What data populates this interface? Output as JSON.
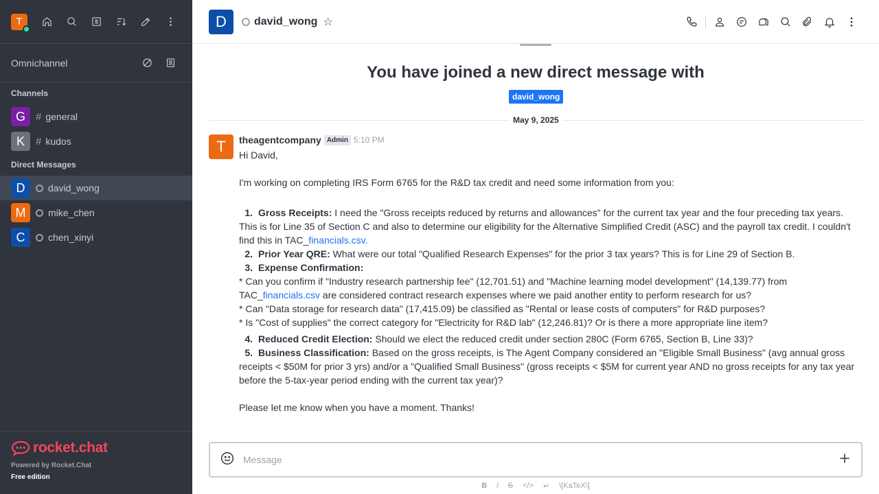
{
  "sidebar": {
    "user_avatar_letter": "T",
    "omnichannel_label": "Omnichannel",
    "channels_title": "Channels",
    "channels": [
      {
        "letter": "G",
        "name": "general",
        "color": "#7a1fa2"
      },
      {
        "letter": "K",
        "name": "kudos",
        "color": "#6c727a"
      }
    ],
    "dm_title": "Direct Messages",
    "dms": [
      {
        "letter": "D",
        "name": "david_wong",
        "color": "#0d4fa8"
      },
      {
        "letter": "M",
        "name": "mike_chen",
        "color": "#ec6b12"
      },
      {
        "letter": "C",
        "name": "chen_xinyi",
        "color": "#0d4fa8"
      }
    ],
    "brand": "rocket.chat",
    "powered_by": "Powered by Rocket.Chat",
    "edition": "Free edition"
  },
  "header": {
    "avatar_letter": "D",
    "room_name": "david_wong"
  },
  "messages": {
    "joined_text": "You have joined a new direct message with",
    "mention": "david_wong",
    "date": "May 9, 2025",
    "message": {
      "avatar_letter": "T",
      "user": "theagentcompany",
      "role": "Admin",
      "time": "5:10 PM",
      "greeting": "Hi David,",
      "intro": "I'm working on completing IRS Form 6765 for the R&D tax credit and need some information from you:",
      "item1_num": "1.",
      "item1_title": "Gross Receipts:",
      "item1_text": " I need the \"Gross receipts reduced by returns and allowances\" for the current tax year and the four preceding tax years. This is for Line 35 of Section C and also to determine our eligibility for the Alternative Simplified Credit (ASC) and the payroll tax credit. I couldn't find this in TAC_",
      "item1_link": "financials.csv.",
      "item2_num": "2.",
      "item2_title": "Prior Year QRE:",
      "item2_text": " What were our total \"Qualified Research Expenses\" for the prior 3 tax years? This is for Line 29 of Section B.",
      "item3_num": "3.",
      "item3_title": "Expense Confirmation:",
      "item3_b1_pre": "* Can you confirm if \"Industry research partnership fee\" (12,701.51) and \"Machine learning model development\" (14,139.77) from TAC_",
      "item3_b1_link": "financials.csv",
      "item3_b1_post": " are considered contract research expenses where we paid another entity to perform research for us?",
      "item3_b2": "* Can \"Data storage for research data\" (17,415.09) be classified as \"Rental or lease costs of computers\" for R&D purposes?",
      "item3_b3": "* Is \"Cost of supplies\" the correct category for \"Electricity for R&D lab\" (12,246.81)? Or is there a more appropriate line item?",
      "item4_num": "4.",
      "item4_title": "Reduced Credit Election:",
      "item4_text": " Should we elect the reduced credit under section 280C (Form 6765, Section B, Line 33)?",
      "item5_num": "5.",
      "item5_title": "Business Classification:",
      "item5_text": " Based on the gross receipts, is The Agent Company considered an \"Eligible Small Business\" (avg annual gross receipts < $50M for prior 3 yrs) and/or a \"Qualified Small Business\" (gross receipts < $5M for current year AND no gross receipts for any tax year before the 5-tax-year period ending with the current tax year)?",
      "closing": "Please let me know when you have a moment. Thanks!"
    }
  },
  "composer": {
    "placeholder": "Message",
    "toolbar": [
      "B",
      "i",
      "S",
      "</>",
      "↵",
      "\\[KaTeX\\]"
    ]
  }
}
